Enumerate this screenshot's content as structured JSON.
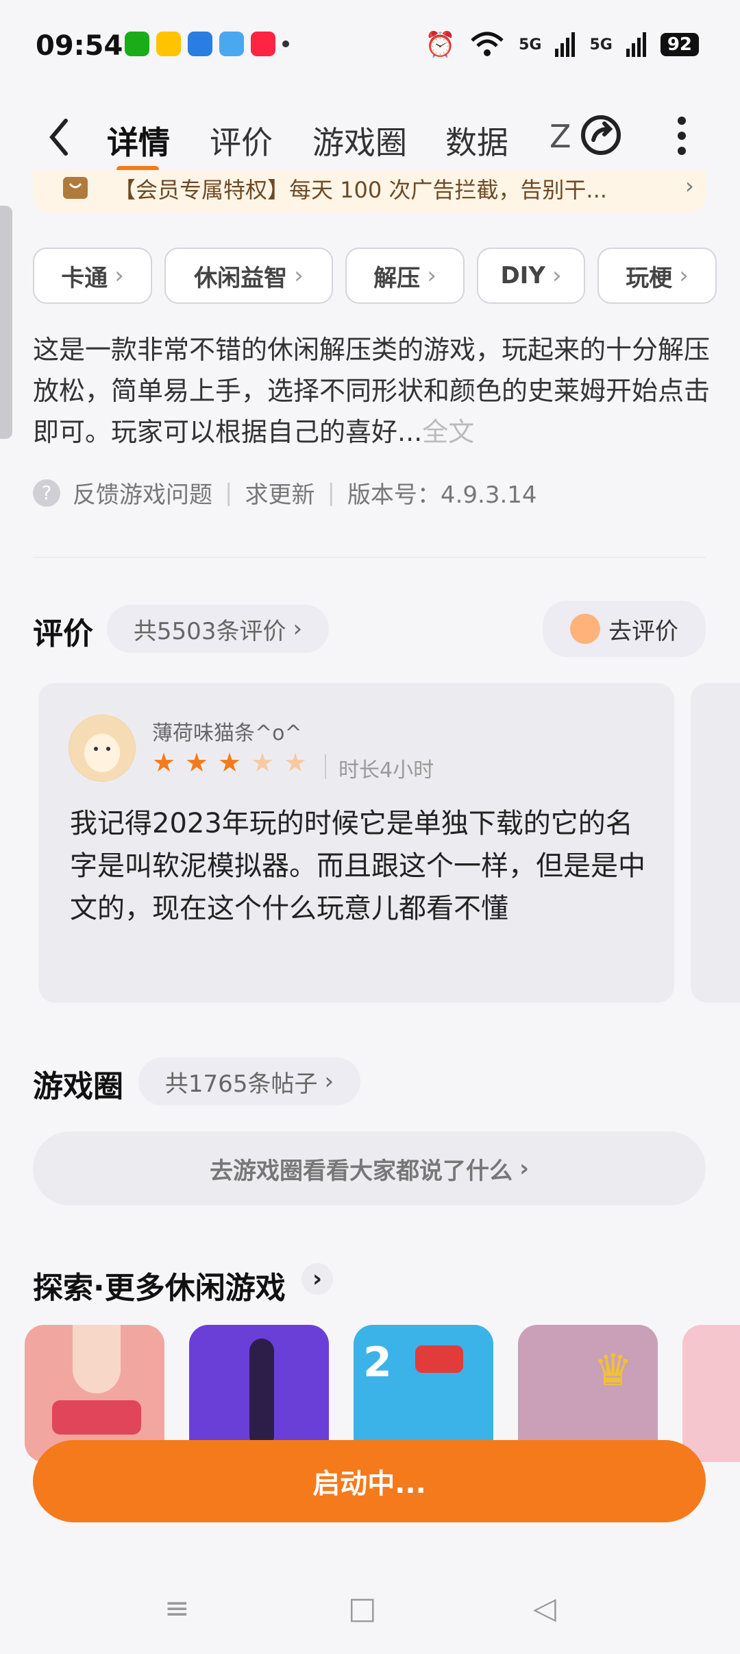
{
  "status_bar": {
    "time": "09:54",
    "signal_label_1": "5G",
    "signal_label_2": "5G",
    "battery": "92"
  },
  "nav": {
    "tabs": [
      "详情",
      "评价",
      "游戏圈",
      "数据",
      "Z"
    ],
    "active_tab": "详情",
    "accent_color": "#f47a1c"
  },
  "banner": {
    "text": "【会员专属特权】每天 100 次广告拦截，告别干..."
  },
  "tags": [
    "卡通",
    "休闲益智",
    "解压",
    "DIY",
    "玩梗"
  ],
  "description": {
    "text": "这是一款非常不错的休闲解压类的游戏，玩起来的十分解压放松，简单易上手，选择不同形状和颜色的史莱姆开始点击即可。玩家可以根据自己的喜好...",
    "more_label": "全文"
  },
  "meta": {
    "feedback": "反馈游戏问题",
    "request_update": "求更新",
    "version": "版本号：4.9.3.14"
  },
  "reviews": {
    "title": "评价",
    "count_label": "共5503条评价",
    "write_button": "去评价",
    "items": [
      {
        "user": "薄荷味猫条^o^",
        "rating": 3,
        "max_rating": 5,
        "playtime": "时长4小时",
        "text": "我记得2023年玩的时候它是单独下载的它的名字是叫软泥模拟器。而且跟这个一样，但是是中文的，现在这个什么玩意儿都看不懂"
      }
    ]
  },
  "game_circle": {
    "title": "游戏圈",
    "count_label": "共1765条帖子",
    "goto_label": "去游戏圈看看大家都说了什么"
  },
  "explore": {
    "title": "探索·更多休闲游戏",
    "thumbs": [
      "press-button-game",
      "runway-girl-game",
      "two-player-car-game",
      "king-knight-game",
      "bride-game"
    ]
  },
  "start_button": "启动中...",
  "system_nav": {
    "menu": "≡",
    "home": "□",
    "back": "◁"
  }
}
